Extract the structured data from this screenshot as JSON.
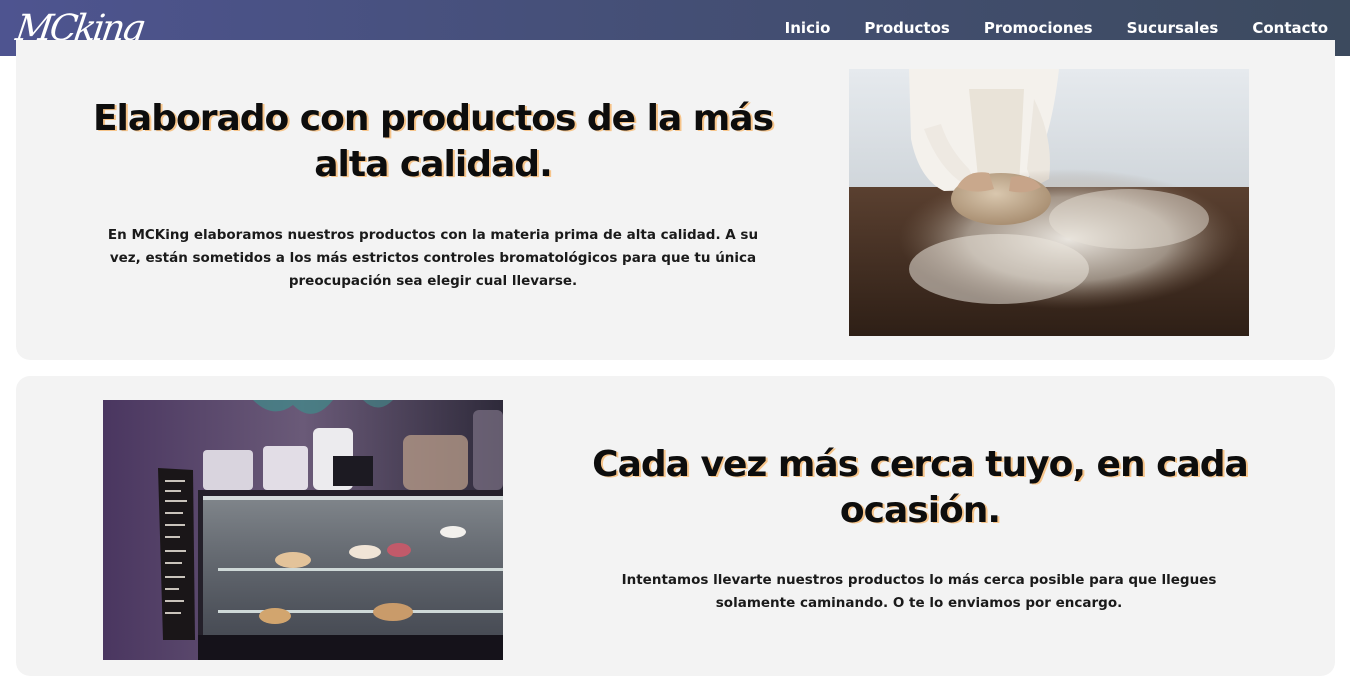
{
  "brand": {
    "logo_text": "MCking"
  },
  "nav": {
    "items": [
      {
        "label": "Inicio"
      },
      {
        "label": "Productos"
      },
      {
        "label": "Promociones"
      },
      {
        "label": "Sucursales"
      },
      {
        "label": "Contacto"
      }
    ]
  },
  "sections": [
    {
      "title": "Elaborado con productos de la más alta calidad.",
      "text": "En MCKing elaboramos nuestros productos con la materia prima de alta calidad. A su vez, están sometidos a los más estrictos controles bromatológicos para que tu única preocupación sea elegir cual llevarse."
    },
    {
      "title": "Cada vez más cerca tuyo, en cada ocasión.",
      "text": "Intentamos llevarte nuestros productos lo más cerca posible para que llegues solamente caminando. O te lo enviamos por encargo."
    }
  ],
  "colors": {
    "nav_gradient_start": "#4e5490",
    "nav_gradient_end": "#3c4a5e",
    "card_background": "#f3f3f3",
    "heading_shadow": "#f6c48a"
  }
}
